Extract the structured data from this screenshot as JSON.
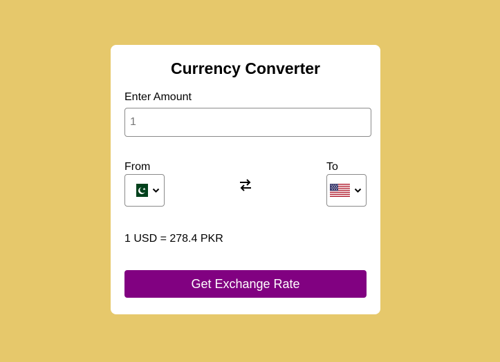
{
  "converter": {
    "title": "Currency Converter",
    "amount_label": "Enter Amount",
    "amount_value": "1",
    "from_label": "From",
    "to_label": "To",
    "from_currency_flag": "pakistan-flag-icon",
    "to_currency_flag": "us-flag-icon",
    "swap_icon": "swap-arrows-icon",
    "rate_text": "1 USD = 278.4 PKR",
    "submit_label": "Get Exchange Rate"
  },
  "colors": {
    "background": "#e6c86b",
    "card": "#ffffff",
    "button": "#810181",
    "button_text": "#ffffff"
  }
}
